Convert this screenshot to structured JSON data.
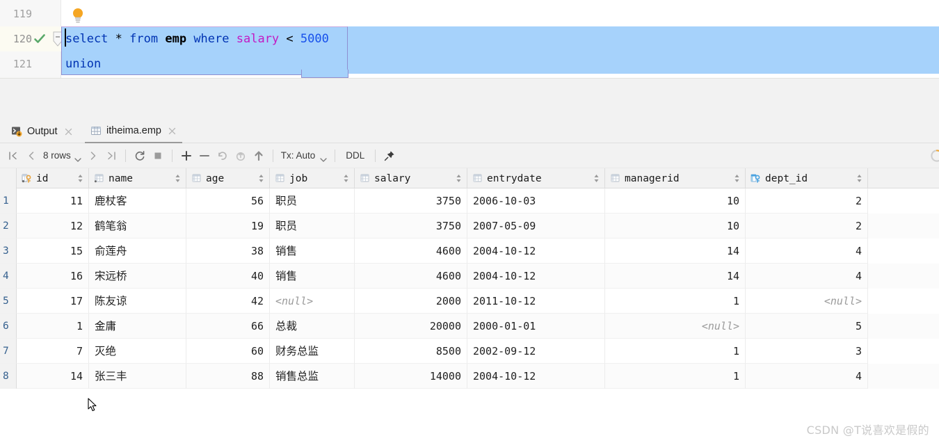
{
  "editor": {
    "lines": [
      {
        "number": "119",
        "tokens": []
      },
      {
        "number": "120",
        "tokens": [
          {
            "text": "select",
            "kind": "keyword"
          },
          {
            "text": " * ",
            "kind": "op"
          },
          {
            "text": "from",
            "kind": "keyword"
          },
          {
            "text": " ",
            "kind": "op"
          },
          {
            "text": "emp",
            "kind": "identifier"
          },
          {
            "text": " ",
            "kind": "op"
          },
          {
            "text": "where",
            "kind": "keyword"
          },
          {
            "text": " ",
            "kind": "op"
          },
          {
            "text": "salary",
            "kind": "column"
          },
          {
            "text": " < ",
            "kind": "op"
          },
          {
            "text": "5000",
            "kind": "number"
          }
        ]
      },
      {
        "number": "121",
        "tokens": [
          {
            "text": "union",
            "kind": "keyword"
          }
        ]
      }
    ],
    "line119": "119",
    "line120": "120",
    "line121": "121",
    "code_line_1": "select * from emp where salary < 5000",
    "code_line_2": "union",
    "gutter_status_icon": "green-check-icon",
    "fold_icon": "fold-minus-icon",
    "intention_icon": "lightbulb-icon",
    "colors": {
      "keyword": "#0033b3",
      "identifier": "#000000",
      "column": "#c31ac3",
      "number": "#1750eb",
      "selection": "#a6d2fb",
      "gutter_bg": "#f7f7f7"
    }
  },
  "tabs": [
    {
      "label": "Output",
      "icon": "console-output-icon",
      "active": false,
      "closable": true
    },
    {
      "label": "itheima.emp",
      "icon": "table-grid-icon",
      "active": true,
      "closable": true
    }
  ],
  "toolbar": {
    "first_page": "go-to-first-page-icon",
    "prev_page": "go-to-previous-page-icon",
    "rows_label": "8 rows",
    "next_page": "go-to-next-page-icon",
    "last_page": "go-to-last-page-icon",
    "reload": "reload-icon",
    "stop": "stop-icon",
    "add_row": "add-row-icon",
    "delete_row": "delete-row-icon",
    "revert": "revert-icon",
    "rollback": "rollback-icon",
    "submit": "submit-icon",
    "tx_label": "Tx: Auto",
    "ddl_label": "DDL",
    "pin": "pin-tab-icon",
    "loading": "loading-spinner-icon"
  },
  "grid": {
    "columns": [
      {
        "name": "id",
        "icon": "primary-key-icon",
        "width_class": "w-id",
        "align": "right"
      },
      {
        "name": "name",
        "icon": "column-icon",
        "width_class": "w-name",
        "align": "left"
      },
      {
        "name": "age",
        "icon": "column-icon",
        "width_class": "w-age",
        "align": "right"
      },
      {
        "name": "job",
        "icon": "column-icon",
        "width_class": "w-job",
        "align": "left"
      },
      {
        "name": "salary",
        "icon": "column-icon",
        "width_class": "w-salary",
        "align": "right"
      },
      {
        "name": "entrydate",
        "icon": "column-icon",
        "width_class": "w-entry",
        "align": "left"
      },
      {
        "name": "managerid",
        "icon": "column-icon",
        "width_class": "w-mgr",
        "align": "right"
      },
      {
        "name": "dept_id",
        "icon": "foreign-key-icon",
        "width_class": "w-dept",
        "align": "right"
      }
    ],
    "null_text": "<null>",
    "rows": [
      {
        "n": "1",
        "id": "11",
        "name": "鹿杖客",
        "age": "56",
        "job": "职员",
        "salary": "3750",
        "entrydate": "2006-10-03",
        "managerid": "10",
        "dept_id": "2"
      },
      {
        "n": "2",
        "id": "12",
        "name": "鹤笔翁",
        "age": "19",
        "job": "职员",
        "salary": "3750",
        "entrydate": "2007-05-09",
        "managerid": "10",
        "dept_id": "2"
      },
      {
        "n": "3",
        "id": "15",
        "name": "俞莲舟",
        "age": "38",
        "job": "销售",
        "salary": "4600",
        "entrydate": "2004-10-12",
        "managerid": "14",
        "dept_id": "4"
      },
      {
        "n": "4",
        "id": "16",
        "name": "宋远桥",
        "age": "40",
        "job": "销售",
        "salary": "4600",
        "entrydate": "2004-10-12",
        "managerid": "14",
        "dept_id": "4"
      },
      {
        "n": "5",
        "id": "17",
        "name": "陈友谅",
        "age": "42",
        "job": "<null>",
        "salary": "2000",
        "entrydate": "2011-10-12",
        "managerid": "1",
        "dept_id": "<null>"
      },
      {
        "n": "6",
        "id": "1",
        "name": "金庸",
        "age": "66",
        "job": "总裁",
        "salary": "20000",
        "entrydate": "2000-01-01",
        "managerid": "<null>",
        "dept_id": "5"
      },
      {
        "n": "7",
        "id": "7",
        "name": "灭绝",
        "age": "60",
        "job": "财务总监",
        "salary": "8500",
        "entrydate": "2002-09-12",
        "managerid": "1",
        "dept_id": "3"
      },
      {
        "n": "8",
        "id": "14",
        "name": "张三丰",
        "age": "88",
        "job": "销售总监",
        "salary": "14000",
        "entrydate": "2004-10-12",
        "managerid": "1",
        "dept_id": "4"
      }
    ]
  },
  "watermark": "CSDN @T说喜欢是假的"
}
